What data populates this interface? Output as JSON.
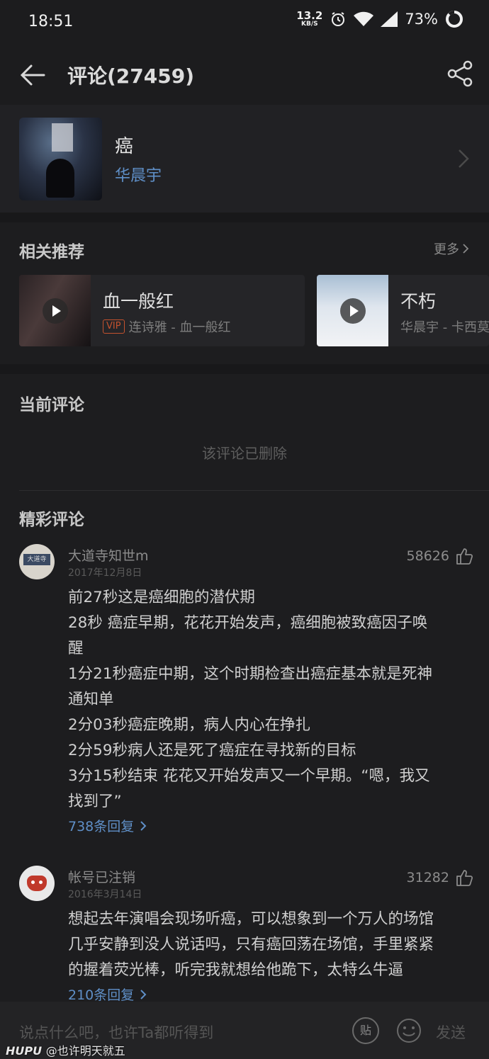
{
  "status_bar": {
    "time": "18:51",
    "net_speed": "13.2",
    "net_unit": "KB/S",
    "battery": "73%"
  },
  "header": {
    "title": "评论(27459)",
    "back_icon": "arrow-left-icon",
    "share_icon": "share-icon"
  },
  "song": {
    "name": "癌",
    "artist": "华晨宇"
  },
  "related": {
    "title": "相关推荐",
    "more_label": "更多",
    "items": [
      {
        "name": "血一般红",
        "vip": "VIP",
        "subtitle": "连诗雅 - 血一般红"
      },
      {
        "name": "不朽",
        "subtitle": "华晨宇 - 卡西莫"
      }
    ]
  },
  "current": {
    "title": "当前评论",
    "deleted_text": "该评论已删除"
  },
  "hot": {
    "title": "精彩评论",
    "comments": [
      {
        "user": "大道寺知世m",
        "avatar_text": "大道寺",
        "date": "2017年12月8日",
        "likes": "58626",
        "lines": [
          "前27秒这是癌细胞的潜伏期",
          "28秒 癌症早期，花花开始发声，癌细胞被致癌因子唤",
          "醒",
          "1分21秒癌症中期，这个时期检查出癌症基本就是死神",
          "通知单",
          "2分03秒癌症晚期，病人内心在挣扎",
          "2分59秒病人还是死了癌症在寻找新的目标",
          "3分15秒结束 花花又开始发声又一个早期。“嗯，我又",
          "找到了”"
        ],
        "replies": "738条回复"
      },
      {
        "user": "帐号已注销",
        "date": "2016年3月14日",
        "likes": "31282",
        "lines": [
          "想起去年演唱会现场听癌，可以想象到一个万人的场馆",
          "几乎安静到没人说话吗，只有癌回荡在场馆，手里紧紧",
          "的握着荧光棒，听完我就想给他跪下，太特么牛逼"
        ],
        "replies": "210条回复"
      }
    ]
  },
  "input_bar": {
    "placeholder": "说点什么吧，也许Ta都听得到",
    "tie_label": "贴",
    "send_label": "发送"
  },
  "watermark": {
    "brand": "HUPU",
    "handle": "@也许明天就五"
  },
  "colors": {
    "background": "#1d1d1f",
    "link": "#5f8fc7",
    "vip": "#c4522e"
  }
}
